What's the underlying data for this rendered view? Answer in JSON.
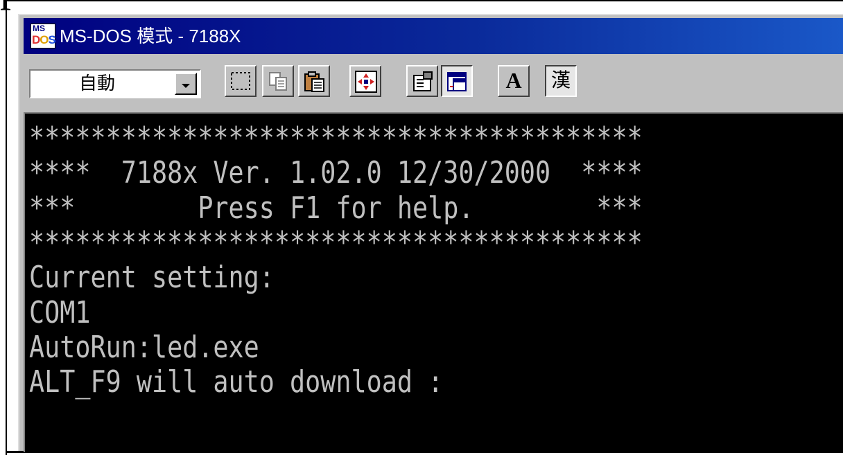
{
  "page": {
    "top_fragment": "p"
  },
  "window": {
    "title": "MS-DOS 模式 - 7188X",
    "icon_label_top": "MS",
    "icon_label_bottom": [
      "D",
      "O",
      "S"
    ]
  },
  "toolbar": {
    "font_select_value": "自動",
    "buttons": [
      {
        "name": "mark",
        "icon": "mark-icon"
      },
      {
        "name": "copy",
        "icon": "copy-icon"
      },
      {
        "name": "paste",
        "icon": "paste-icon"
      },
      {
        "name": "fullscreen",
        "icon": "fullscreen-icon"
      },
      {
        "name": "properties",
        "icon": "properties-icon"
      },
      {
        "name": "background",
        "icon": "background-icon",
        "pressed": true
      },
      {
        "name": "font",
        "icon": "font-icon",
        "glyph": "A"
      },
      {
        "name": "chinese-input",
        "icon": "chinese-char-icon",
        "glyph": "漢"
      }
    ]
  },
  "console": {
    "lines": [
      "****************************************",
      "****  7188x Ver. 1.02.0 12/30/2000  ****",
      "***        Press F1 for help.        ***",
      "****************************************",
      "Current setting:",
      "COM1",
      "AutoRun:led.exe",
      "ALT_F9 will auto download :"
    ]
  },
  "colors": {
    "title_bar_start": "#000080",
    "title_bar_end": "#1a58c8",
    "console_background": "#000000",
    "console_text": "#c0c0c0",
    "window_chrome": "#c0c0c0"
  }
}
